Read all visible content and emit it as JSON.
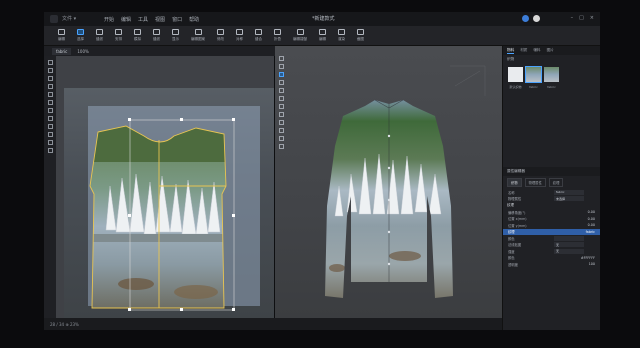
{
  "app": {
    "file_menu": "文件 ▾",
    "menu": [
      "开始",
      "编辑",
      "工具",
      "视图",
      "窗口",
      "帮助"
    ],
    "title": "*新建款式"
  },
  "toolbar": {
    "tools": [
      "编辑",
      "选择",
      "缝纫",
      "安排",
      "模拟",
      "缝纫",
      "显示",
      "编辑图案",
      "修改",
      "对称",
      "缝合",
      "折叠",
      "编辑褶皱",
      "编辑",
      "渲染",
      "截图"
    ]
  },
  "subbar": {
    "fabric_label": "fabric",
    "opacity_label": "100%"
  },
  "statusbar": {
    "zoom_text": "28 / 34  ⊕ 23%"
  },
  "right_panel": {
    "tabs": [
      "物料",
      "材质",
      "辅料",
      "图片"
    ],
    "section_title": "织物",
    "thumb_labels": [
      "默认织物",
      "fabric",
      "fabric"
    ],
    "props_title": "属性编辑器",
    "prop_tabs": [
      "织物",
      "物理属性",
      "纹理"
    ],
    "rows": [
      {
        "k": "名称",
        "v": "fabric"
      },
      {
        "k": "物理属性",
        "v": "未选择"
      },
      {
        "k": "纹理",
        "v": ""
      },
      {
        "k": "偏移角度(°)",
        "v": "0.00"
      },
      {
        "k": "位置 x(mm)",
        "v": "0.00"
      },
      {
        "k": "位置 y(mm)",
        "v": "0.00"
      },
      {
        "k": "纹理",
        "v": "fabric"
      },
      {
        "k": "颜色",
        "v": ""
      },
      {
        "k": "法线贴图",
        "v": "无"
      },
      {
        "k": "强度",
        "v": "无"
      },
      {
        "k": "颜色",
        "v": "#FFFFFF"
      },
      {
        "k": "透明度",
        "v": "100"
      }
    ]
  },
  "colors": {
    "accent": "#4aa3ff",
    "bg": "#1c1d21",
    "pattern_line": "#e8c552"
  }
}
